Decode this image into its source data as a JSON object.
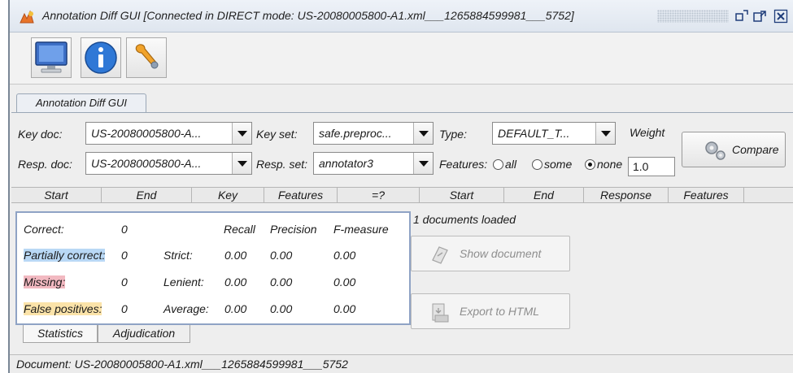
{
  "window": {
    "title": "Annotation Diff GUI [Connected in DIRECT mode: US-20080005800-A1.xml___1265884599981___5752]"
  },
  "toolbar": {
    "buttons": [
      {
        "name": "monitor",
        "icon": "monitor-icon"
      },
      {
        "name": "info",
        "icon": "info-icon"
      },
      {
        "name": "tools",
        "icon": "wrench-icon"
      }
    ]
  },
  "main_tab": {
    "label": "Annotation Diff GUI"
  },
  "form": {
    "key_doc_label": "Key doc:",
    "key_doc_value": "US-20080005800-A...",
    "key_set_label": "Key set:",
    "key_set_value": "safe.preproc...",
    "type_label": "Type:",
    "type_value": "DEFAULT_T...",
    "weight_label": "Weight",
    "resp_doc_label": "Resp. doc:",
    "resp_doc_value": "US-20080005800-A...",
    "resp_set_label": "Resp. set:",
    "resp_set_value": "annotator3",
    "features_label": "Features:",
    "features_options": [
      "all",
      "some",
      "none"
    ],
    "features_selected": "none",
    "weight_value": "1.0",
    "compare_label": "Compare"
  },
  "columns": [
    "Start",
    "End",
    "Key",
    "Features",
    "=?",
    "Start",
    "End",
    "Response",
    "Features"
  ],
  "statistics": {
    "correct_label": "Correct:",
    "correct_value": "0",
    "partial_label": "Partially correct:",
    "partial_value": "0",
    "missing_label": "Missing:",
    "missing_value": "0",
    "false_pos_label": "False positives:",
    "false_pos_value": "0",
    "headers": {
      "recall": "Recall",
      "precision": "Precision",
      "fmeasure": "F-measure"
    },
    "rows": [
      {
        "label": "Strict:",
        "recall": "0.00",
        "precision": "0.00",
        "fmeasure": "0.00"
      },
      {
        "label": "Lenient:",
        "recall": "0.00",
        "precision": "0.00",
        "fmeasure": "0.00"
      },
      {
        "label": "Average:",
        "recall": "0.00",
        "precision": "0.00",
        "fmeasure": "0.00"
      }
    ]
  },
  "bottom_tabs": [
    "Statistics",
    "Adjudication"
  ],
  "side": {
    "docs_loaded": "1 documents loaded",
    "show_document": "Show document",
    "export_html": "Export to HTML"
  },
  "status": {
    "text": "Document: US-20080005800-A1.xml___1265884599981___5752"
  },
  "colors": {
    "partial": "#b9d8f5",
    "missing": "#f2b9c1",
    "false_positive": "#fbe3a9",
    "stats_border": "#8fa3c5"
  }
}
